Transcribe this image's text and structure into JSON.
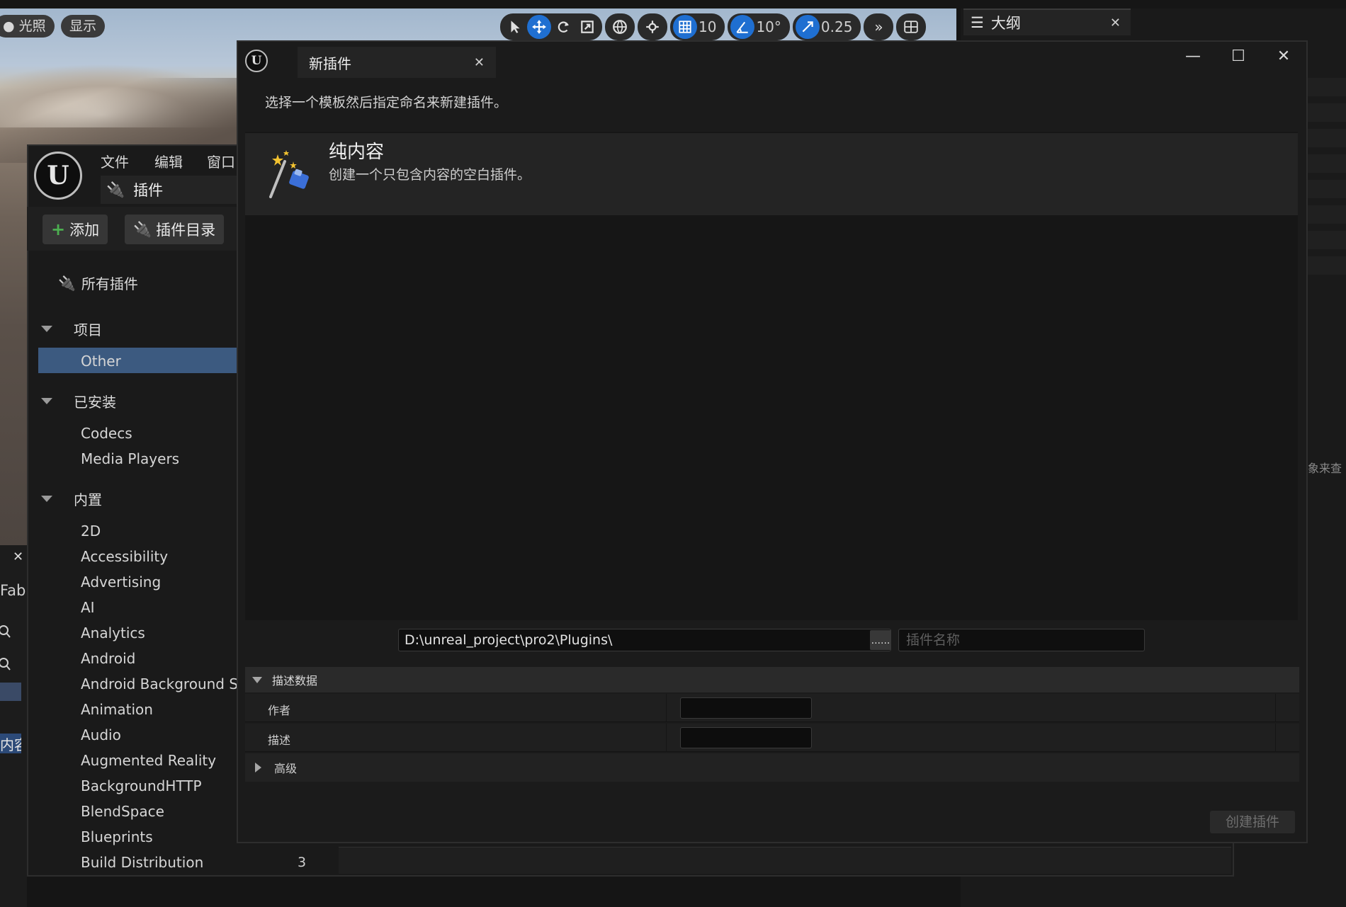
{
  "viewport": {
    "lighting_label": "光照",
    "show_label": "显示",
    "grid_snap_value": "10",
    "rotate_snap_value": "10°",
    "scale_snap_value": "0.25"
  },
  "outline": {
    "tab_label": "大纲",
    "hint_fragment": "象来查"
  },
  "left_panel": {
    "fab_fragment": "Fab",
    "content_fragment": "内容"
  },
  "plugins_window": {
    "menu": [
      "文件",
      "编辑",
      "窗口"
    ],
    "tab_label": "插件",
    "add_button": "添加",
    "catalog_button": "插件目录",
    "all_plugins": "所有插件",
    "project_heading": "项目",
    "project_items": [
      "Other"
    ],
    "installed_heading": "已安装",
    "installed_items": [
      "Codecs",
      "Media Players"
    ],
    "builtin_heading": "内置",
    "builtin_items": [
      "2D",
      "Accessibility",
      "Advertising",
      "AI",
      "Analytics",
      "Android",
      "Android Background Serv",
      "Animation",
      "Audio",
      "Augmented Reality",
      "BackgroundHTTP",
      "BlendSpace",
      "Blueprints",
      "Build Distribution"
    ],
    "build_distribution_count": "3"
  },
  "dialog": {
    "tab_title": "新插件",
    "instruction": "选择一个模板然后指定命名来新建插件。",
    "template": {
      "title": "纯内容",
      "description": "创建一个只包含内容的空白插件。"
    },
    "path_value": "D:\\unreal_project\\pro2\\Plugins\\",
    "browse_label": "......",
    "name_placeholder": "插件名称",
    "metadata_header": "描述数据",
    "author_label": "作者",
    "description_label": "描述",
    "advanced_label": "高级",
    "create_button": "创建插件"
  },
  "colors": {
    "accent_blue": "#1f6fd1",
    "selection": "#3c5a80",
    "background": "#1b1b1b"
  }
}
